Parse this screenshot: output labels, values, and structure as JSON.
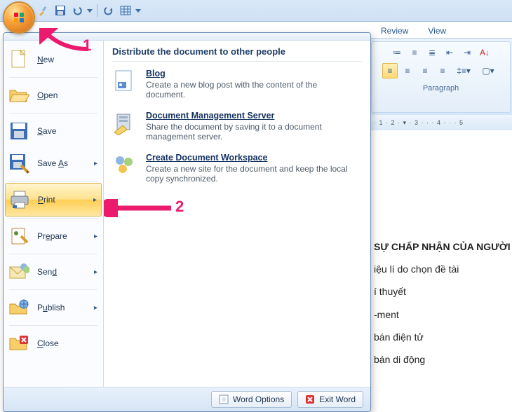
{
  "qat": {
    "buttons": [
      "paintbrush-icon",
      "save-icon",
      "undo-icon",
      "dropdown-icon",
      "redo-icon",
      "table-icon",
      "dropdown-icon"
    ]
  },
  "ribbon": {
    "tabs": [
      "Review",
      "View"
    ],
    "paragraph_label": "Paragraph"
  },
  "ruler_text": "· 1 · 2 · ▾ · 3 · · · 4 · · · 5",
  "menu": {
    "left": [
      {
        "key": "new",
        "label": "New",
        "u": "N",
        "icon": "new"
      },
      {
        "key": "open",
        "label": "Open",
        "u": "O",
        "icon": "open"
      },
      {
        "key": "save",
        "label": "Save",
        "u": "S",
        "icon": "save"
      },
      {
        "key": "saveas",
        "label": "Save As",
        "u": "A",
        "icon": "saveas",
        "sub": true
      },
      {
        "key": "print",
        "label": "Print",
        "u": "P",
        "icon": "print",
        "sub": true,
        "active": true
      },
      {
        "key": "prepare",
        "label": "Prepare",
        "u": "r",
        "icon": "prepare",
        "sub": true
      },
      {
        "key": "send",
        "label": "Send",
        "u": "d",
        "icon": "send",
        "sub": true
      },
      {
        "key": "publish",
        "label": "Publish",
        "u": "u",
        "icon": "publish",
        "sub": true
      },
      {
        "key": "close",
        "label": "Close",
        "u": "C",
        "icon": "close"
      }
    ],
    "right_title": "Distribute the document to other people",
    "right": [
      {
        "key": "blog",
        "head": "Blog",
        "desc": "Create a new blog post with the content of the document."
      },
      {
        "key": "dms",
        "head": "Document Management Server",
        "desc": "Share the document by saving it to a document management server."
      },
      {
        "key": "cdw",
        "head": "Create Document Workspace",
        "desc": "Create a new site for the document and keep the local copy synchronized."
      }
    ],
    "bottom": {
      "word_options": "Word Options",
      "exit_word": "Exit Word"
    }
  },
  "document_lines": [
    "SỰ CHẤP NHẬN CỦA NGƯỜI",
    "iệu lí do chọn đề tài",
    "í thuyết",
    "-ment",
    "bán điện tử",
    "bán di động"
  ],
  "annotations": {
    "one": "1",
    "two": "2"
  }
}
